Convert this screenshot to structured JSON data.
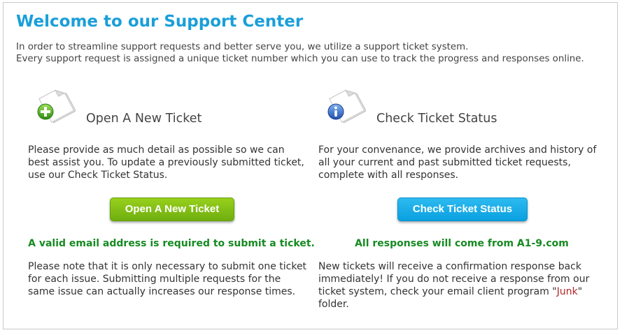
{
  "page": {
    "title": "Welcome to our Support Center",
    "intro_line1": "In order to streamline support requests and better serve you, we utilize a support ticket system.",
    "intro_line2": "Every support request is assigned a unique ticket number which you can use to track the progress and responses online."
  },
  "new_ticket": {
    "icon": "add-document-icon",
    "heading": "Open A New Ticket",
    "description": "Please provide as much detail as possible so we can best assist you. To update a previously submitted ticket, use our Check Ticket Status.",
    "button_label": "Open A New Ticket",
    "note": "A valid email address is required to submit a ticket.",
    "paragraph": "Please note that it is only necessary to submit one ticket for each issue. Submitting multiple requests for the same issue can actually increases our response times."
  },
  "check_status": {
    "icon": "info-document-icon",
    "heading": "Check Ticket Status",
    "description": "For your convenance, we provide archives and history of all your current and past submitted ticket requests, complete with all responses.",
    "button_label": "Check Ticket Status",
    "note": "All responses will come from A1-9.com",
    "paragraph_before": "New tickets will receive a confirmation response back immediately! If you do not receive a response from our ticket system, check your email client program \"",
    "paragraph_link": "Junk",
    "paragraph_after": "\" folder."
  },
  "colors": {
    "title": "#1a9fd9",
    "green_button": "#7dbd14",
    "blue_button": "#1aaeea",
    "note_green": "#168a22",
    "junk_red": "#b32525"
  }
}
